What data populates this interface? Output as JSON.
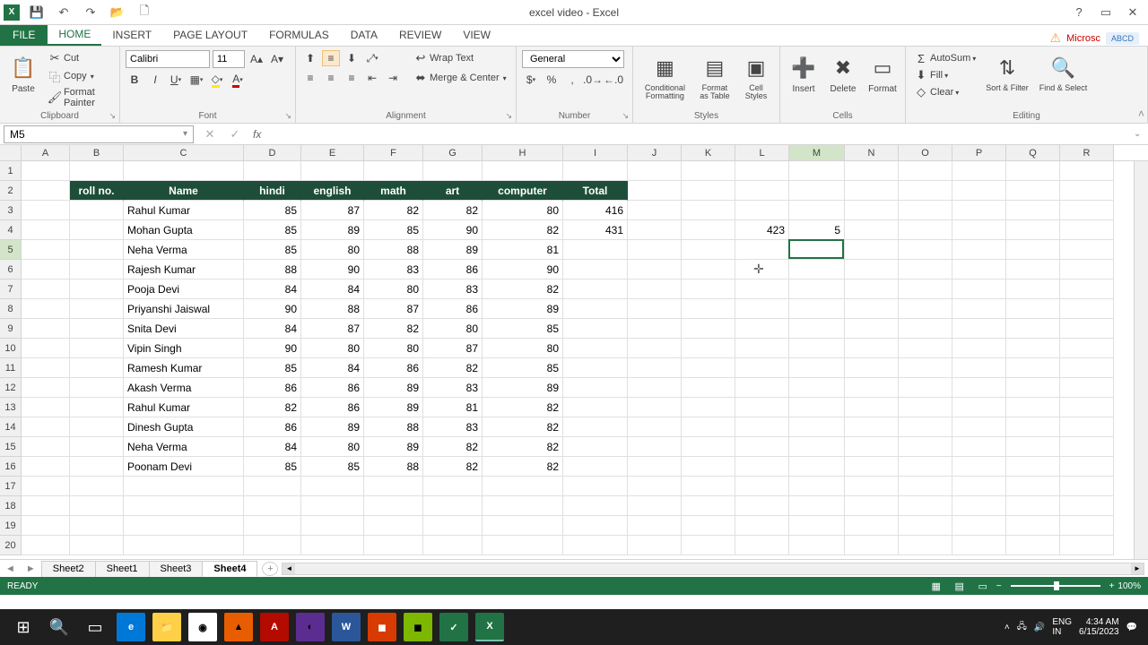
{
  "title": "excel video - Excel",
  "quickAccess": {
    "save": "💾",
    "undo": "↶",
    "redo": "↷",
    "open": "📂",
    "new": "🗋"
  },
  "tabs": {
    "file": "FILE",
    "home": "HOME",
    "insert": "INSERT",
    "pageLayout": "PAGE LAYOUT",
    "formulas": "FORMULAS",
    "data": "DATA",
    "review": "REVIEW",
    "view": "VIEW"
  },
  "msAccount": "Microsc",
  "abcd": "ABCD",
  "ribbon": {
    "clipboard": {
      "paste": "Paste",
      "cut": "Cut",
      "copy": "Copy",
      "formatPainter": "Format Painter",
      "label": "Clipboard"
    },
    "font": {
      "name": "Calibri",
      "size": "11",
      "label": "Font"
    },
    "alignment": {
      "wrap": "Wrap Text",
      "merge": "Merge & Center",
      "label": "Alignment"
    },
    "number": {
      "format": "General",
      "label": "Number"
    },
    "styles": {
      "cond": "Conditional Formatting",
      "fat": "Format as Table",
      "cell": "Cell Styles",
      "label": "Styles"
    },
    "cells": {
      "insert": "Insert",
      "delete": "Delete",
      "format": "Format",
      "label": "Cells"
    },
    "editing": {
      "autosum": "AutoSum",
      "fill": "Fill",
      "clear": "Clear",
      "sort": "Sort & Filter",
      "find": "Find & Select",
      "label": "Editing"
    }
  },
  "nameBox": "M5",
  "formulaBar": "",
  "columns": [
    "A",
    "B",
    "C",
    "D",
    "E",
    "F",
    "G",
    "H",
    "I",
    "J",
    "K",
    "L",
    "M",
    "N",
    "O",
    "P",
    "Q",
    "R"
  ],
  "colWidths": {
    "A": 54,
    "B": 60,
    "C": 134,
    "D": 64,
    "E": 70,
    "F": 66,
    "G": 66,
    "H": 90,
    "I": 72,
    "J": 60,
    "K": 60,
    "L": 60,
    "M": 62,
    "N": 60,
    "O": 60,
    "P": 60,
    "Q": 60,
    "R": 60
  },
  "activeCol": "M",
  "activeRow": 5,
  "rowCount": 20,
  "headerRow": {
    "B": "roll no.",
    "C": "Name",
    "D": "hindi",
    "E": "english",
    "F": "math",
    "G": "art",
    "H": "computer",
    "I": "Total"
  },
  "chart_data": {
    "type": "table",
    "columns": [
      "Name",
      "hindi",
      "english",
      "math",
      "art",
      "computer",
      "Total"
    ],
    "rows": [
      [
        "Rahul Kumar",
        85,
        87,
        82,
        82,
        80,
        416
      ],
      [
        "Mohan Gupta",
        85,
        89,
        85,
        90,
        82,
        431
      ],
      [
        "Neha Verma",
        85,
        80,
        88,
        89,
        81,
        null
      ],
      [
        "Rajesh Kumar",
        88,
        90,
        83,
        86,
        90,
        null
      ],
      [
        "Pooja Devi",
        84,
        84,
        80,
        83,
        82,
        null
      ],
      [
        "Priyanshi Jaiswal",
        90,
        88,
        87,
        86,
        89,
        null
      ],
      [
        "Snita Devi",
        84,
        87,
        82,
        80,
        85,
        null
      ],
      [
        "Vipin Singh",
        90,
        80,
        80,
        87,
        80,
        null
      ],
      [
        "Ramesh Kumar",
        85,
        84,
        86,
        82,
        85,
        null
      ],
      [
        "Akash Verma",
        86,
        86,
        89,
        83,
        89,
        null
      ],
      [
        "Rahul Kumar",
        82,
        86,
        89,
        81,
        82,
        null
      ],
      [
        "Dinesh Gupta",
        86,
        89,
        88,
        83,
        82,
        null
      ],
      [
        "Neha Verma",
        84,
        80,
        89,
        82,
        82,
        null
      ],
      [
        "Poonam Devi",
        85,
        85,
        88,
        82,
        82,
        null
      ]
    ]
  },
  "extraCells": {
    "L4": "423",
    "M4": "5"
  },
  "sheets": [
    "Sheet2",
    "Sheet1",
    "Sheet3",
    "Sheet4"
  ],
  "activeSheet": "Sheet4",
  "status": "READY",
  "zoom": "100%",
  "tray": {
    "lang": "ENG",
    "kbd": "IN",
    "time": "4:34 AM",
    "date": "6/15/2023"
  }
}
